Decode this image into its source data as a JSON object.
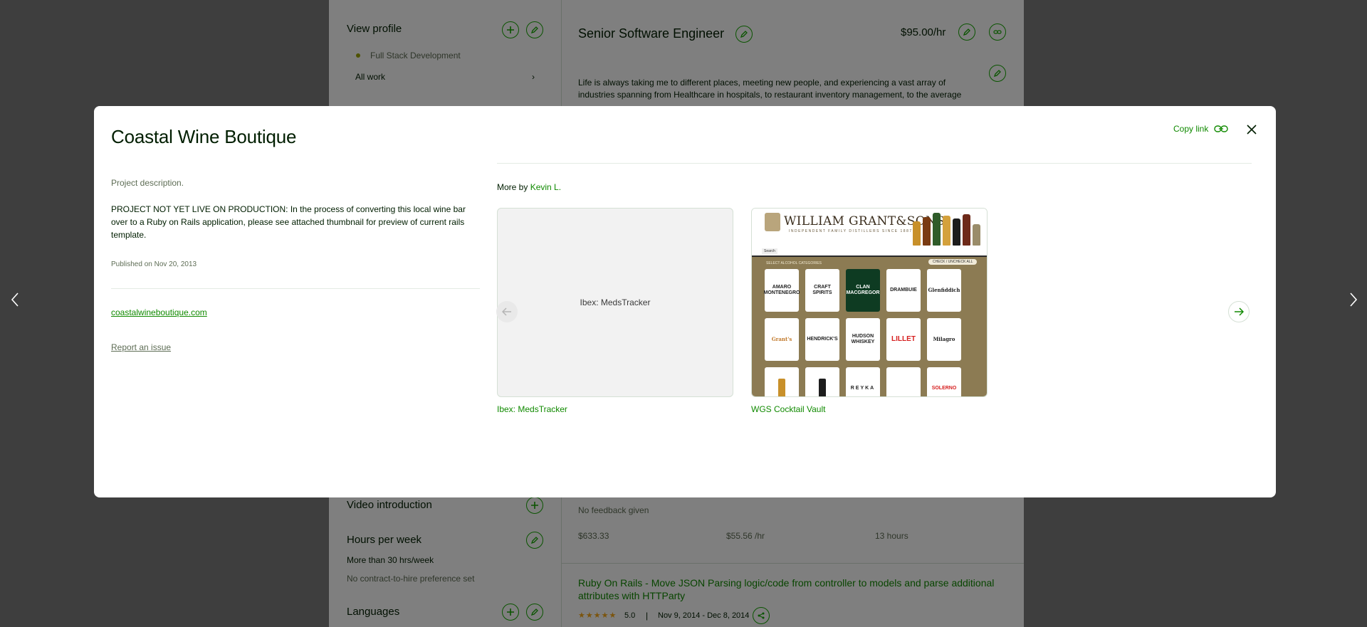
{
  "background": {
    "left": {
      "view_profile": "View profile",
      "specialty": "Full Stack Development",
      "all_work": "All work",
      "video_intro": "Video introduction",
      "hours_title": "Hours per week",
      "hours_value": "More than 30 hrs/week",
      "hire_pref": "No contract-to-hire preference set",
      "languages": "Languages"
    },
    "right": {
      "job_title": "Senior Software Engineer",
      "rate": "$95.00/hr",
      "overview_line1": "Life is always taking me to different places, meeting new people, and experiencing a vast array of",
      "overview_line2": "industries spanning from Healthcare in hospitals, to restaurant inventory management, to the average",
      "feedback": "No feedback given",
      "earned": "$633.33",
      "hourly": "$55.56 /hr",
      "hours": "13 hours",
      "job2_title": "Ruby On Rails - Move JSON Parsing logic/code from controller to models and parse additional attributes with HTTParty",
      "rating": "5.0",
      "dates": "Nov 9, 2014 - Dec 8, 2014"
    }
  },
  "modal": {
    "title": "Coastal Wine Boutique",
    "copy_link": "Copy link",
    "description_label": "Project description.",
    "description": "PROJECT NOT YET LIVE ON PRODUCTION: In the process of converting this local wine bar over to a Ruby on Rails application, please see attached thumbnail for preview of current rails template.",
    "published": "Published on Nov 20, 2013",
    "website": "coastalwineboutique.com",
    "report": "Report an issue",
    "more_by_prefix": "More by ",
    "more_by_author": "Kevin L.",
    "cards": [
      {
        "title": "Ibex: MedsTracker",
        "thumb_text": "Ibex: MedsTracker"
      },
      {
        "title": "WGS Cocktail Vault"
      }
    ]
  },
  "wgs_thumb": {
    "logo": "WILLIAM GRANT&SONS",
    "tagline": "INDEPENDENT FAMILY DISTILLERS SINCE 1887",
    "tab": "Search",
    "select": "SELECT ALCOHOL CATEGORIES",
    "check": "CHECK / UNCHECK ALL",
    "tiles": [
      "AMARO MONTENEGRO",
      "CRAFT SPIRITS",
      "CLAN MACGREGOR",
      "DRAMBUIE",
      "Glenfiddich",
      "Grant's",
      "HENDRICK'S",
      "HUDSON WHISKEY",
      "LILLET",
      "Milagro",
      "",
      "",
      "REYKA",
      "",
      "SOLERNO"
    ]
  },
  "colors": {
    "accent": "#108a00",
    "star": "#f6a91a"
  }
}
